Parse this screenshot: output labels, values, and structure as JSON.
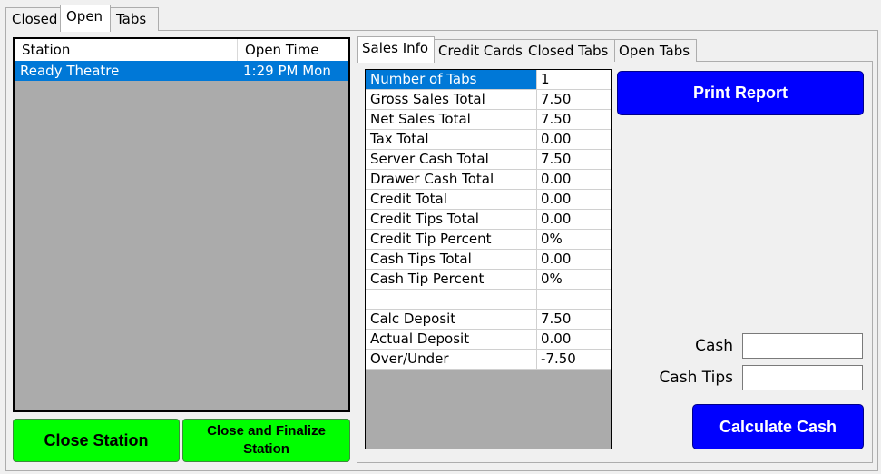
{
  "top_tabs": [
    {
      "label": "Closed"
    },
    {
      "label": "Open"
    },
    {
      "label": "Tabs"
    }
  ],
  "station_list": {
    "columns": [
      "Station",
      "Open Time"
    ],
    "rows": [
      {
        "station": "Ready Theatre",
        "open_time": "1:29 PM Mon"
      }
    ]
  },
  "buttons": {
    "close_station": "Close Station",
    "close_finalize": "Close and Finalize Station",
    "print_report": "Print Report",
    "calculate_cash": "Calculate Cash"
  },
  "right_tabs": [
    {
      "label": "Sales Info"
    },
    {
      "label": "Credit Cards"
    },
    {
      "label": "Closed Tabs"
    },
    {
      "label": "Open Tabs"
    }
  ],
  "sales_info": [
    {
      "label": "Number of Tabs",
      "value": "1"
    },
    {
      "label": "Gross Sales Total",
      "value": "7.50"
    },
    {
      "label": "Net Sales Total",
      "value": "7.50"
    },
    {
      "label": "Tax Total",
      "value": "0.00"
    },
    {
      "label": "Server Cash Total",
      "value": "7.50"
    },
    {
      "label": "Drawer Cash Total",
      "value": "0.00"
    },
    {
      "label": "Credit Total",
      "value": "0.00"
    },
    {
      "label": "Credit Tips Total",
      "value": "0.00"
    },
    {
      "label": "Credit Tip Percent",
      "value": "0%"
    },
    {
      "label": "Cash Tips Total",
      "value": "0.00"
    },
    {
      "label": "Cash Tip Percent",
      "value": "0%"
    },
    {
      "label": "",
      "value": ""
    },
    {
      "label": "Calc Deposit",
      "value": "7.50"
    },
    {
      "label": "Actual Deposit",
      "value": "0.00"
    },
    {
      "label": "Over/Under",
      "value": "-7.50"
    }
  ],
  "cash_form": {
    "cash_label": "Cash",
    "cash_value": "",
    "cash_tips_label": "Cash Tips",
    "cash_tips_value": ""
  },
  "colors": {
    "selection": "#0078d7",
    "green_button": "#00ff00",
    "blue_button": "#0000ff",
    "list_background": "#ababab"
  }
}
